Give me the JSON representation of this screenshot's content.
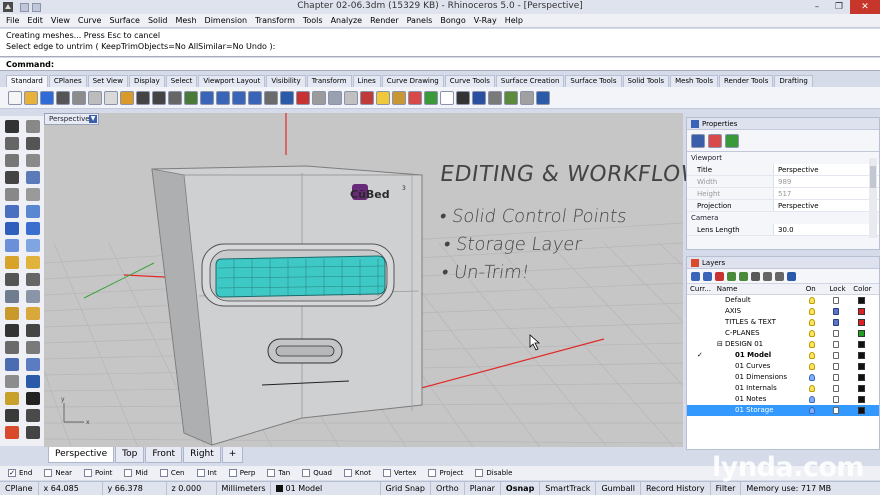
{
  "title": "Chapter 02-06.3dm (15329 KB) - Rhinoceros 5.0 - [Perspective]",
  "menu": [
    "File",
    "Edit",
    "View",
    "Curve",
    "Surface",
    "Solid",
    "Mesh",
    "Dimension",
    "Transform",
    "Tools",
    "Analyze",
    "Render",
    "Panels",
    "Bongo",
    "V-Ray",
    "Help"
  ],
  "history": [
    "Creating meshes... Press Esc to cancel",
    "Select edge to untrim ( KeepTrimObjects=No  AllSimilar=No  Undo ):"
  ],
  "command": {
    "label": "Command:",
    "value": ""
  },
  "toolbar_tabs": [
    "Standard",
    "CPlanes",
    "Set View",
    "Display",
    "Select",
    "Viewport Layout",
    "Visibility",
    "Transform",
    "Lines",
    "Curve Drawing",
    "Curve Tools",
    "Surface Creation",
    "Surface Tools",
    "Solid Tools",
    "Mesh Tools",
    "Render Tools",
    "Drafting"
  ],
  "toolbar_icons": [
    "new-icon",
    "open-icon",
    "save-icon",
    "print-icon",
    "import-icon",
    "cut-icon",
    "copy-icon",
    "paste-icon",
    "undo-icon",
    "redo-icon",
    "pan-icon",
    "rotate-icon",
    "zoom-in-icon",
    "zoom-extents-icon",
    "zoom-window-icon",
    "zoom-selected-icon",
    "grid-icon",
    "four-view-icon",
    "car-icon",
    "cylinder-icon",
    "sphere-icon",
    "select-icon",
    "osnap-icon",
    "bulb-icon",
    "lock-icon",
    "color-wheel-icon",
    "globe-icon",
    "sphere-white-icon",
    "sphere-dark-icon",
    "sphere-blue-icon",
    "gear-icon",
    "puzzle-icon",
    "dots-icon",
    "help-icon"
  ],
  "toolbar_colors": [
    "#f5f5f5",
    "#e8b23a",
    "#2f6bd8",
    "#555555",
    "#8c8c8c",
    "#bcbcbc",
    "#d9d9d9",
    "#d89a2b",
    "#444444",
    "#444444",
    "#666666",
    "#4a7a3a",
    "#3a64b8",
    "#3a64b8",
    "#3a64b8",
    "#3a64b8",
    "#6b6b6b",
    "#2b5ba8",
    "#c73232",
    "#9b9b9b",
    "#9aa0b0",
    "#c0c0c0",
    "#c03a3a",
    "#f0c93a",
    "#c89632",
    "#d84a4a",
    "#3a9a3a",
    "#ffffff",
    "#333333",
    "#2b4fa0",
    "#7a7a7a",
    "#5a8a3a",
    "#a0a0a0",
    "#2b5ba8"
  ],
  "left_icons": [
    "select-arrow-icon",
    "point-icon",
    "line-icon",
    "polyline-icon",
    "circle-icon",
    "arc-icon",
    "rectangle-icon",
    "polygon-icon",
    "curve-icon",
    "fillet-icon",
    "surface-icon",
    "revolve-icon",
    "box-icon",
    "cylinder-icon",
    "extrude-icon",
    "loft-icon",
    "boolean-icon",
    "join-icon",
    "move-icon",
    "rotate-icon",
    "mesh-icon",
    "explode-icon",
    "split-icon",
    "trim-icon",
    "text-icon",
    "dimension-icon",
    "array-icon",
    "mirror-icon",
    "offset-icon",
    "project-icon",
    "analyze-icon",
    "render-icon",
    "block-icon",
    "check-icon",
    "material-icon",
    "cube-icon",
    "paint-icon",
    "history-icon"
  ],
  "left_colors": [
    "#333333",
    "#888888",
    "#666666",
    "#555555",
    "#777777",
    "#8a8a8a",
    "#444444",
    "#5b7ab8",
    "#888888",
    "#9a9a9a",
    "#4a6fc0",
    "#5b86d0",
    "#2e5fbd",
    "#3a6fd0",
    "#6b8fd8",
    "#7fa6e0",
    "#d8a32b",
    "#e0b33c",
    "#555555",
    "#666666",
    "#6f7d8f",
    "#8a96a8",
    "#c99a2b",
    "#d8a83a",
    "#333333",
    "#444444",
    "#6a6a6a",
    "#7a7a7a",
    "#4b6cb0",
    "#5b7cc0",
    "#8c8c8c",
    "#2a5aa8",
    "#c7a12a",
    "#222222",
    "#3a3a3a",
    "#4a4a4a",
    "#d84a2b",
    "#444444"
  ],
  "viewport": {
    "name": "Perspective",
    "overlay_title": "EDITING & WORKFLOW",
    "bullets": [
      "Solid Control Points",
      "Storage Layer",
      "Un-Trim!"
    ],
    "logo_text": "CūBed",
    "logo_sup": "3",
    "colors": {
      "bg": "#c6c6c7",
      "grid": "#b3b3b3",
      "axis_red": "#e12a2a",
      "axis_green": "#3aa33a",
      "panel": "#cfd0d2",
      "window": "#3ec9c6"
    }
  },
  "viewport_tabs": [
    "Perspective",
    "Top",
    "Front",
    "Right"
  ],
  "osnap": [
    {
      "label": "End",
      "checked": true
    },
    {
      "label": "Near",
      "checked": false
    },
    {
      "label": "Point",
      "checked": false
    },
    {
      "label": "Mid",
      "checked": false
    },
    {
      "label": "Cen",
      "checked": false
    },
    {
      "label": "Int",
      "checked": false
    },
    {
      "label": "Perp",
      "checked": false
    },
    {
      "label": "Tan",
      "checked": false
    },
    {
      "label": "Quad",
      "checked": false
    },
    {
      "label": "Knot",
      "checked": false
    },
    {
      "label": "Vertex",
      "checked": false
    },
    {
      "label": "Project",
      "checked": false
    },
    {
      "label": "Disable",
      "checked": false
    }
  ],
  "status": {
    "cplane": "CPlane",
    "x": "x 64.085",
    "y": "y 66.378",
    "z": "z 0.000",
    "units": "Millimeters",
    "layer": "01 Model",
    "toggles": [
      "Grid Snap",
      "Ortho",
      "Planar",
      "Osnap",
      "SmartTrack",
      "Gumball",
      "Record History",
      "Filter"
    ],
    "memory": "Memory use: 717 MB"
  },
  "properties": {
    "title": "Properties",
    "section_viewport": "Viewport",
    "rows": [
      {
        "k": "Title",
        "v": "Perspective",
        "disabled": false
      },
      {
        "k": "Width",
        "v": "989",
        "disabled": true
      },
      {
        "k": "Height",
        "v": "517",
        "disabled": true
      },
      {
        "k": "Projection",
        "v": "Perspective",
        "disabled": false
      }
    ],
    "section_camera": "Camera",
    "lens_label": "Lens Length",
    "lens_value": "30.0"
  },
  "layers": {
    "title": "Layers",
    "cols": {
      "current": "Curr...",
      "name": "Name",
      "on": "On",
      "lock": "Lock",
      "color": "Color"
    },
    "rows": [
      {
        "name": "Default",
        "indent": 0,
        "bulb": "yellow",
        "locked": false,
        "color": "#111111",
        "bold": false,
        "current": false,
        "selected": false
      },
      {
        "name": "AXIS",
        "indent": 0,
        "bulb": "yellow",
        "locked": true,
        "color": "#e02020",
        "bold": false,
        "current": false,
        "selected": false
      },
      {
        "name": "TITLES & TEXT",
        "indent": 0,
        "bulb": "yellow",
        "locked": true,
        "color": "#e02020",
        "bold": false,
        "current": false,
        "selected": false
      },
      {
        "name": "C-PLANES",
        "indent": 0,
        "bulb": "yellow",
        "locked": false,
        "color": "#22a022",
        "bold": false,
        "current": false,
        "selected": false
      },
      {
        "name": "DESIGN 01",
        "indent": 0,
        "bulb": "yellow",
        "locked": false,
        "color": "#111111",
        "bold": false,
        "current": false,
        "selected": false,
        "expander": "⊟"
      },
      {
        "name": "01 Model",
        "indent": 1,
        "bulb": "yellow",
        "locked": false,
        "color": "#111111",
        "bold": true,
        "current": true,
        "selected": false
      },
      {
        "name": "01 Curves",
        "indent": 1,
        "bulb": "yellow",
        "locked": false,
        "color": "#111111",
        "bold": false,
        "current": false,
        "selected": false
      },
      {
        "name": "01 Dimensions",
        "indent": 1,
        "bulb": "blue",
        "locked": false,
        "color": "#111111",
        "bold": false,
        "current": false,
        "selected": false
      },
      {
        "name": "01 Internals",
        "indent": 1,
        "bulb": "yellow",
        "locked": false,
        "color": "#111111",
        "bold": false,
        "current": false,
        "selected": false
      },
      {
        "name": "01 Notes",
        "indent": 1,
        "bulb": "blue",
        "locked": false,
        "color": "#111111",
        "bold": false,
        "current": false,
        "selected": false
      },
      {
        "name": "01 Storage",
        "indent": 1,
        "bulb": "blue",
        "locked": false,
        "color": "#111111",
        "bold": false,
        "current": false,
        "selected": true
      }
    ],
    "tools": [
      "new-layer-icon",
      "new-sublayer-icon",
      "delete-icon",
      "up-icon",
      "down-icon",
      "parent-icon",
      "filter-icon",
      "tools-icon",
      "help-icon"
    ],
    "tool_colors": [
      "#3a64b8",
      "#3a64b8",
      "#c83232",
      "#4a8a3a",
      "#4a8a3a",
      "#5a5a5a",
      "#666666",
      "#666666",
      "#2b5ba8"
    ]
  },
  "watermark": "lynda.com"
}
